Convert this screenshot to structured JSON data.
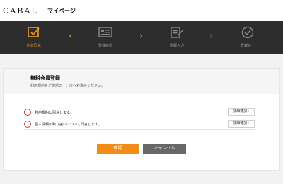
{
  "header": {
    "logo": "CABAL",
    "mypage": "マイページ"
  },
  "steps": [
    {
      "label": "約款同意",
      "icon": "checklist-icon",
      "active": true
    },
    {
      "label": "登録確認",
      "icon": "id-card-icon",
      "active": false
    },
    {
      "label": "情報入力",
      "icon": "edit-icon",
      "active": false
    },
    {
      "label": "登録完了",
      "icon": "check-circle-icon",
      "active": false
    }
  ],
  "card": {
    "title": "無料会員登録",
    "subtitle": "利用規約をご確認の上、次へお進みください。",
    "agreements": [
      {
        "text": "利用規約に同意します。",
        "detail_label": "詳細確認 ›"
      },
      {
        "text": "個人情報の取り扱いについて同意します。",
        "detail_label": "詳細確認 ›"
      }
    ]
  },
  "buttons": {
    "confirm": "確認",
    "cancel": "キャンセル"
  },
  "colors": {
    "accent": "#f28c16",
    "dark_bar": "#2d2d2d",
    "radio_border": "#c0392b"
  }
}
